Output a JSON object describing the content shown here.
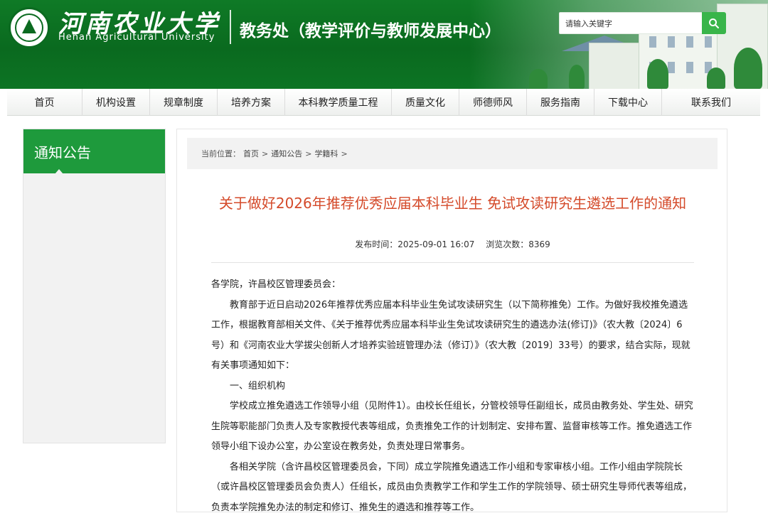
{
  "header": {
    "school_name_cn": "河南农业大学",
    "school_name_en": "Henan Agricultural University",
    "department": "教务处（教学评价与教师发展中心）",
    "search_placeholder": "请输入关键字",
    "colors": {
      "primary_green": "#0f7a26",
      "search_button": "#39b54a"
    }
  },
  "nav": {
    "items": [
      "首页",
      "机构设置",
      "规章制度",
      "培养方案",
      "本科教学质量工程",
      "质量文化",
      "师德师风",
      "服务指南",
      "下载中心",
      "联系我们"
    ]
  },
  "sidebar": {
    "title": "通知公告"
  },
  "breadcrumb": {
    "prefix": "当前位置：",
    "items": [
      "首页",
      "通知公告",
      "学籍科"
    ],
    "separator": ">"
  },
  "article": {
    "title": "关于做好2026年推荐优秀应届本科毕业生 免试攻读研究生遴选工作的通知",
    "publish_label": "发布时间：",
    "publish_time": "2025-09-01 16:07",
    "views_label": "浏览次数：",
    "views": "8369",
    "title_color": "#d44a2a",
    "paragraphs": [
      "各学院，许昌校区管理委员会：",
      "教育部于近日启动2026年推荐优秀应届本科毕业生免试攻读研究生（以下简称推免）工作。为做好我校推免遴选工作，根据教育部相关文件、《关于推荐优秀应届本科毕业生免试攻读研究生的遴选办法(修订)》（农大教〔2024〕6号）和《河南农业大学拔尖创新人才培养实验班管理办法（修订）》（农大教〔2019〕33号）的要求，结合实际，现就有关事项通知如下：",
      "一、组织机构",
      "学校成立推免遴选工作领导小组（见附件1）。由校长任组长，分管校领导任副组长，成员由教务处、学生处、研究生院等职能部门负责人及专家教授代表等组成，负责推免工作的计划制定、安排布置、监督审核等工作。推免遴选工作领导小组下设办公室，办公室设在教务处，负责处理日常事务。",
      "各相关学院（含许昌校区管理委员会，下同）成立学院推免遴选工作小组和专家审核小组。工作小组由学院院长（或许昌校区管理委员会负责人）任组长，成员由负责教学工作和学生工作的学院领导、硕士研究生导师代表等组成，负责本学院推免办法的制定和修订、推免生的遴选和推荐等工作。"
    ]
  }
}
